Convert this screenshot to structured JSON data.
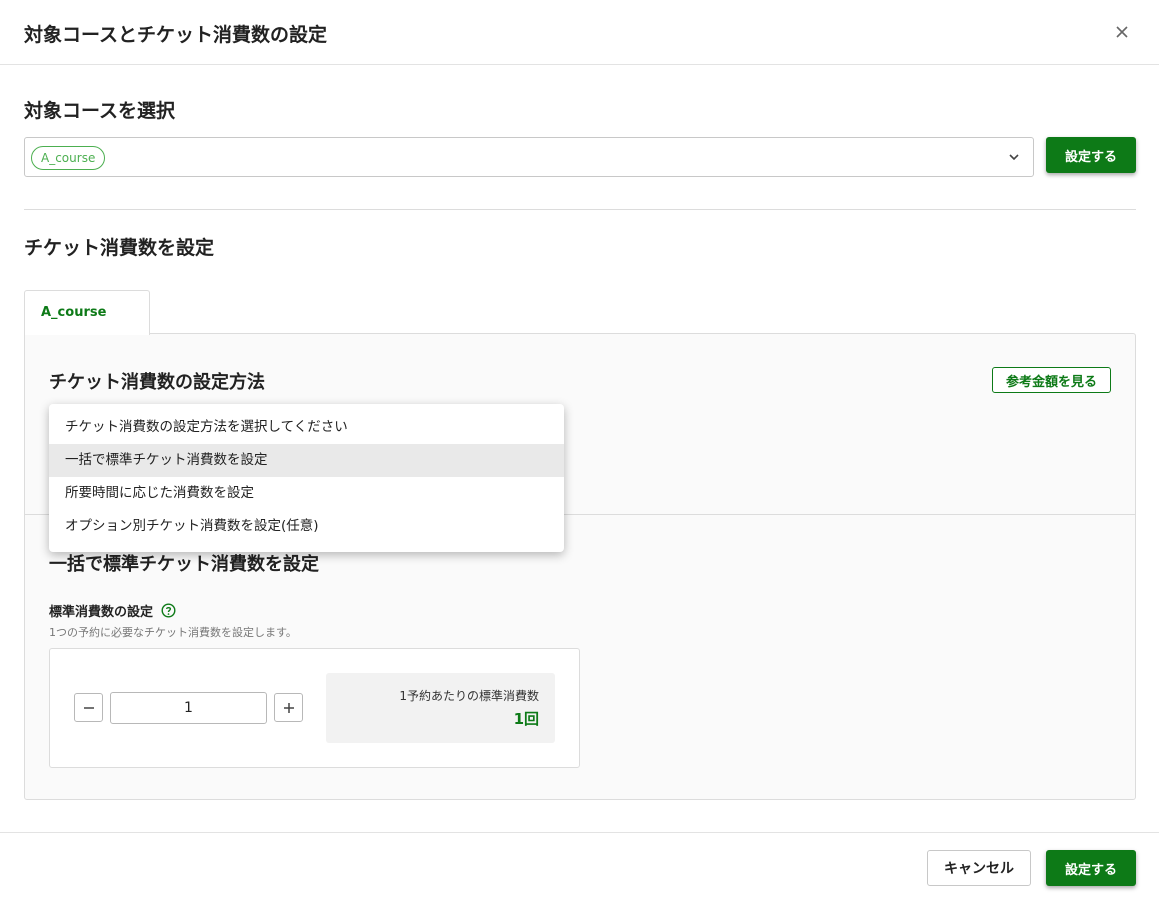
{
  "dialog": {
    "title": "対象コースとチケット消費数の設定"
  },
  "course_section": {
    "heading": "対象コースを選択",
    "selected_chips": [
      "A_course"
    ],
    "set_button": "設定する"
  },
  "ticket_section": {
    "heading": "チケット消費数を設定",
    "tabs": [
      {
        "label": "A_course",
        "active": true
      }
    ],
    "method_heading": "チケット消費数の設定方法",
    "reference_button": "参考金額を見る",
    "dropdown": {
      "options": [
        "チケット消費数の設定方法を選択してください",
        "一括で標準チケット消費数を設定",
        "所要時間に応じた消費数を設定",
        "オプション別チケット消費数を設定(任意)"
      ],
      "highlighted_index": 1
    },
    "bulk_heading": "一括で標準チケット消費数を設定",
    "standard_label": "標準消費数の設定",
    "help_text": "1つの予約に必要なチケット消費数を設定します。",
    "quantity": "1",
    "summary_label": "1予約あたりの標準消費数",
    "summary_value": "1回"
  },
  "footer": {
    "cancel": "キャンセル",
    "submit": "設定する"
  },
  "colors": {
    "accent": "#0d7a17",
    "chip": "#4caf50"
  }
}
